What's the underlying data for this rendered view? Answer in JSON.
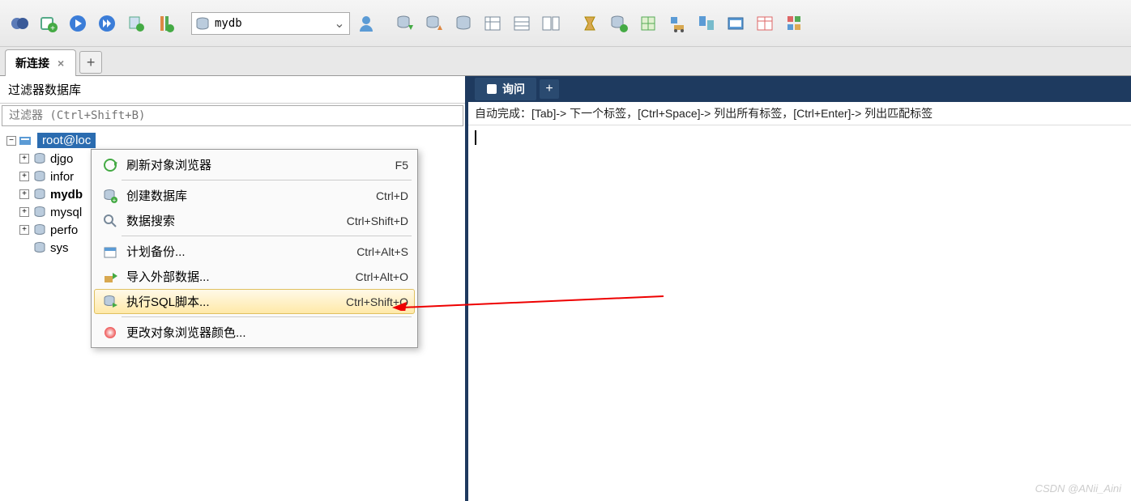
{
  "toolbar": {
    "db_value": "mydb"
  },
  "tabs": {
    "connection_tab": "新连接"
  },
  "left": {
    "filter_header": "过滤器数据库",
    "filter_placeholder": "过滤器 (Ctrl+Shift+B)",
    "root": "root@loc",
    "databases": [
      "djgo",
      "infor",
      "mydb",
      "mysql",
      "perfo",
      "sys"
    ]
  },
  "context_menu": {
    "items": [
      {
        "label": "刷新对象浏览器",
        "shortcut": "F5"
      },
      {
        "label": "创建数据库",
        "shortcut": "Ctrl+D"
      },
      {
        "label": "数据搜索",
        "shortcut": "Ctrl+Shift+D"
      },
      {
        "label": "计划备份...",
        "shortcut": "Ctrl+Alt+S"
      },
      {
        "label": "导入外部数据...",
        "shortcut": "Ctrl+Alt+O"
      },
      {
        "label": "执行SQL脚本...",
        "shortcut": "Ctrl+Shift+Q"
      },
      {
        "label": "更改对象浏览器颜色..."
      }
    ]
  },
  "right": {
    "query_tab": "询问",
    "hint": "自动完成：[Tab]-> 下一个标签，[Ctrl+Space]-> 列出所有标签，[Ctrl+Enter]-> 列出匹配标签"
  },
  "watermark": "CSDN @ANii_Aini"
}
